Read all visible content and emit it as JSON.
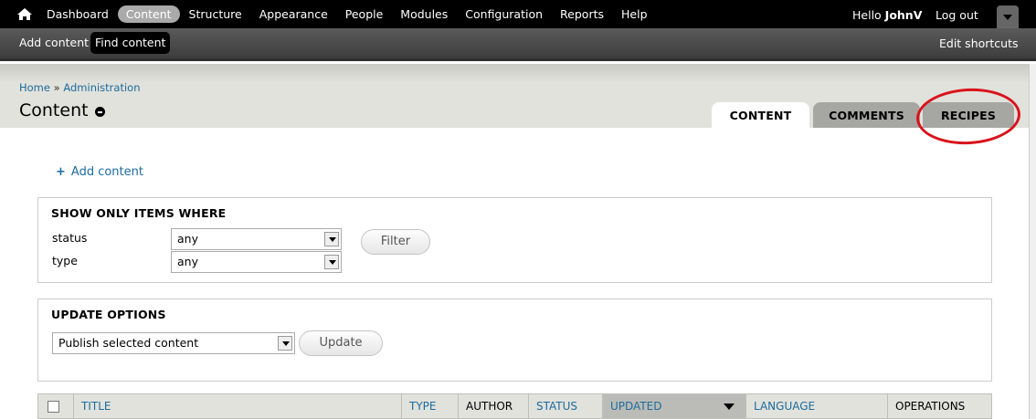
{
  "toolbar": {
    "menu": [
      "Dashboard",
      "Content",
      "Structure",
      "Appearance",
      "People",
      "Modules",
      "Configuration",
      "Reports",
      "Help"
    ],
    "active_index": 1,
    "hello": "Hello",
    "username": "JohnV",
    "logout": "Log out"
  },
  "shortcuts": {
    "add_content": "Add content",
    "find_content": "Find content",
    "edit": "Edit shortcuts"
  },
  "header": {
    "breadcrumb_home": "Home",
    "breadcrumb_sep": "»",
    "breadcrumb_admin": "Administration",
    "title": "Content"
  },
  "tabs": {
    "content": "CONTENT",
    "comments": "COMMENTS",
    "recipes": "RECIPES"
  },
  "actions": {
    "add_content": "Add content"
  },
  "filter": {
    "title": "SHOW ONLY ITEMS WHERE",
    "status_label": "status",
    "status_value": "any",
    "type_label": "type",
    "type_value": "any",
    "button": "Filter"
  },
  "update": {
    "title": "UPDATE OPTIONS",
    "selected": "Publish selected content",
    "button": "Update"
  },
  "table": {
    "title": "TITLE",
    "type": "TYPE",
    "author": "AUTHOR",
    "status": "STATUS",
    "updated": "UPDATED",
    "language": "LANGUAGE",
    "operations": "OPERATIONS"
  },
  "colors": {
    "link": "#1c6b9e",
    "highlight": "#d9131b"
  }
}
